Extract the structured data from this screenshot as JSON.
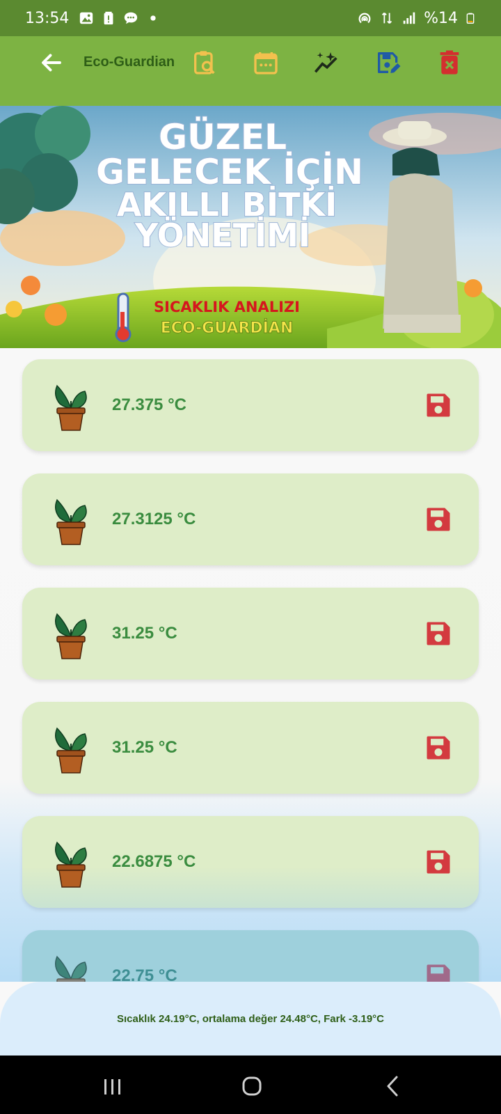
{
  "status_bar": {
    "time": "13:54",
    "battery_text": "%14",
    "left_icons": [
      "gallery-icon",
      "battery-alert-icon",
      "message-icon",
      "dot-icon"
    ],
    "right_icons": [
      "hotspot-icon",
      "data-arrows-icon",
      "signal-icon",
      "battery-icon"
    ]
  },
  "app_bar": {
    "title": "Eco-Guardian",
    "back_icon": "arrow-left-icon",
    "actions": [
      {
        "icon": "clipboard-search-icon",
        "color": "#f2c14e"
      },
      {
        "icon": "calendar-icon",
        "color": "#f2c14e"
      },
      {
        "icon": "chart-sparkle-icon",
        "color": "#1e2a1a"
      },
      {
        "icon": "save-edit-icon",
        "color": "#1f5aa6"
      },
      {
        "icon": "delete-icon",
        "color": "#d32f2f"
      }
    ]
  },
  "banner": {
    "headline": [
      "GÜZEL",
      "GELECEK İÇİN",
      "AKILLI BİTKİ",
      "YÖNETİMİ"
    ],
    "subtitle": "SICAKLIK ANALIZI",
    "brand": "ECO-GUARDİAN"
  },
  "readings": [
    {
      "temp": "27.375 °C"
    },
    {
      "temp": "27.3125 °C"
    },
    {
      "temp": "31.25 °C"
    },
    {
      "temp": "31.25 °C"
    },
    {
      "temp": "22.6875 °C"
    },
    {
      "temp": "22.75 °C"
    }
  ],
  "summary": {
    "text": "Sıcaklık 24.19°C, ortalama değer 24.48°C, Fark -3.19°C"
  },
  "colors": {
    "status_bar": "#5b8a30",
    "app_bar": "#7db343",
    "card": "#deedc8",
    "temp_text": "#3a8c3f",
    "save_icon": "#d33a3f",
    "bottom_sheet": "#dbedfb"
  }
}
